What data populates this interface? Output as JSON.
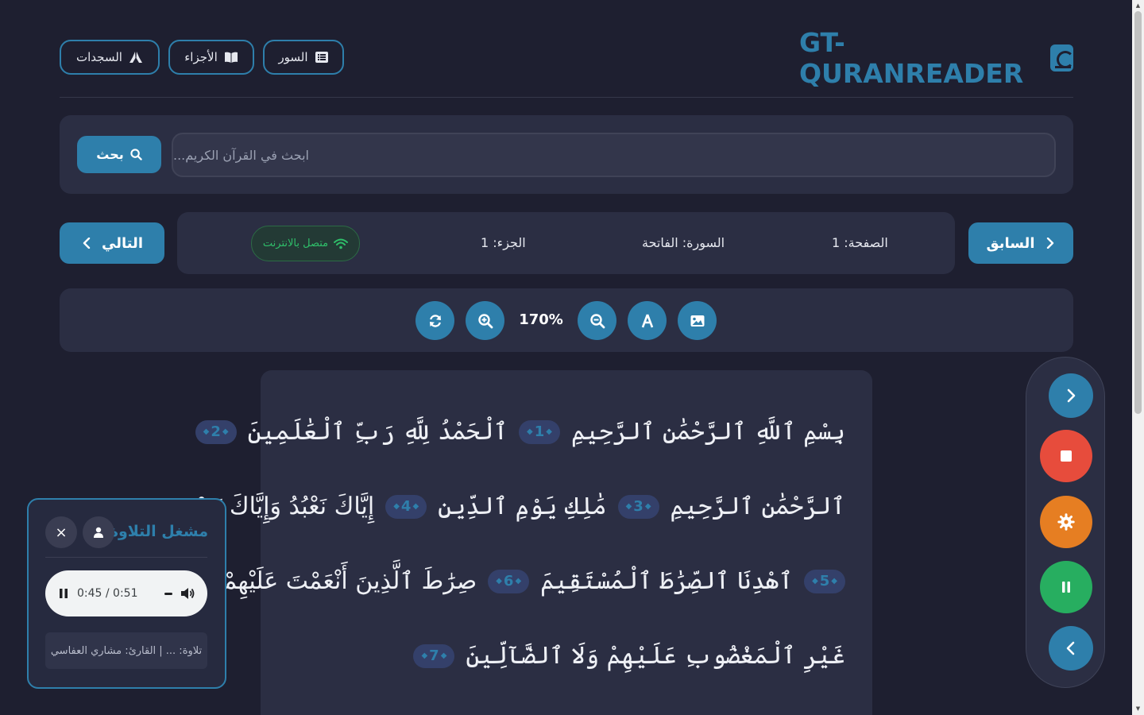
{
  "header": {
    "brand": "GT-QURANREADER",
    "brand_icon": "quran-logo-icon",
    "nav": [
      {
        "label": "السور",
        "icon": "list-icon"
      },
      {
        "label": "الأجزاء",
        "icon": "book-open-icon"
      },
      {
        "label": "السجدات",
        "icon": "praying-hands-icon"
      }
    ]
  },
  "search": {
    "placeholder": "ابحث في القرآن الكريم...",
    "button_label": "بحث"
  },
  "navigation": {
    "prev_label": "السابق",
    "next_label": "التالي",
    "page": "الصفحة: 1",
    "surah": "السورة: الفاتحة",
    "juz": "الجزء: 1",
    "status": "متصل بالانترنت"
  },
  "toolbar": {
    "zoom": "170%"
  },
  "quran": {
    "lines": [
      {
        "text": "بِسْمِ ٱللَّهِ ٱلرَّحْمَٰنِ ٱلرَّحِيمِ",
        "num": "1",
        "text2": "ٱلْحَمْدُ لِلَّهِ رَبِّ ٱلْعَٰلَمِينَ",
        "num2": "2"
      },
      {
        "text": "ٱلرَّحْمَٰنِ ٱلرَّحِيمِ",
        "num": "3",
        "text2": "مَٰلِكِ يَوْمِ ٱلدِّينِ",
        "num2": "4",
        "text3": "إِيَّاكَ نَعْبُدُ وَإِيَّاكَ نَسْتَعِينُ"
      },
      {
        "text": "ٱهْدِنَا ٱلصِّرَٰطَ ٱلْمُسْتَقِيمَ",
        "num": "6",
        "text2": "صِرَٰطَ ٱلَّذِينَ أَنْعَمْتَ عَلَيْهِمْ",
        "num0": "5"
      },
      {
        "text": "غَيْرِ ٱلْمَغْضُوبِ عَلَيْهِمْ وَلَا ٱلضَّآلِّينَ",
        "num": "7"
      }
    ]
  },
  "player": {
    "title": "مشغل التلاوة",
    "time": "0:45 / 0:51",
    "reciter": "تلاوة: ... | القارئ: مشاري العفاسي",
    "close": "×"
  },
  "colors": {
    "accent": "#2e7fab",
    "stop": "#e74c3c",
    "settings": "#e67e22",
    "play": "#27ae60",
    "online": "#2fbf6a"
  }
}
